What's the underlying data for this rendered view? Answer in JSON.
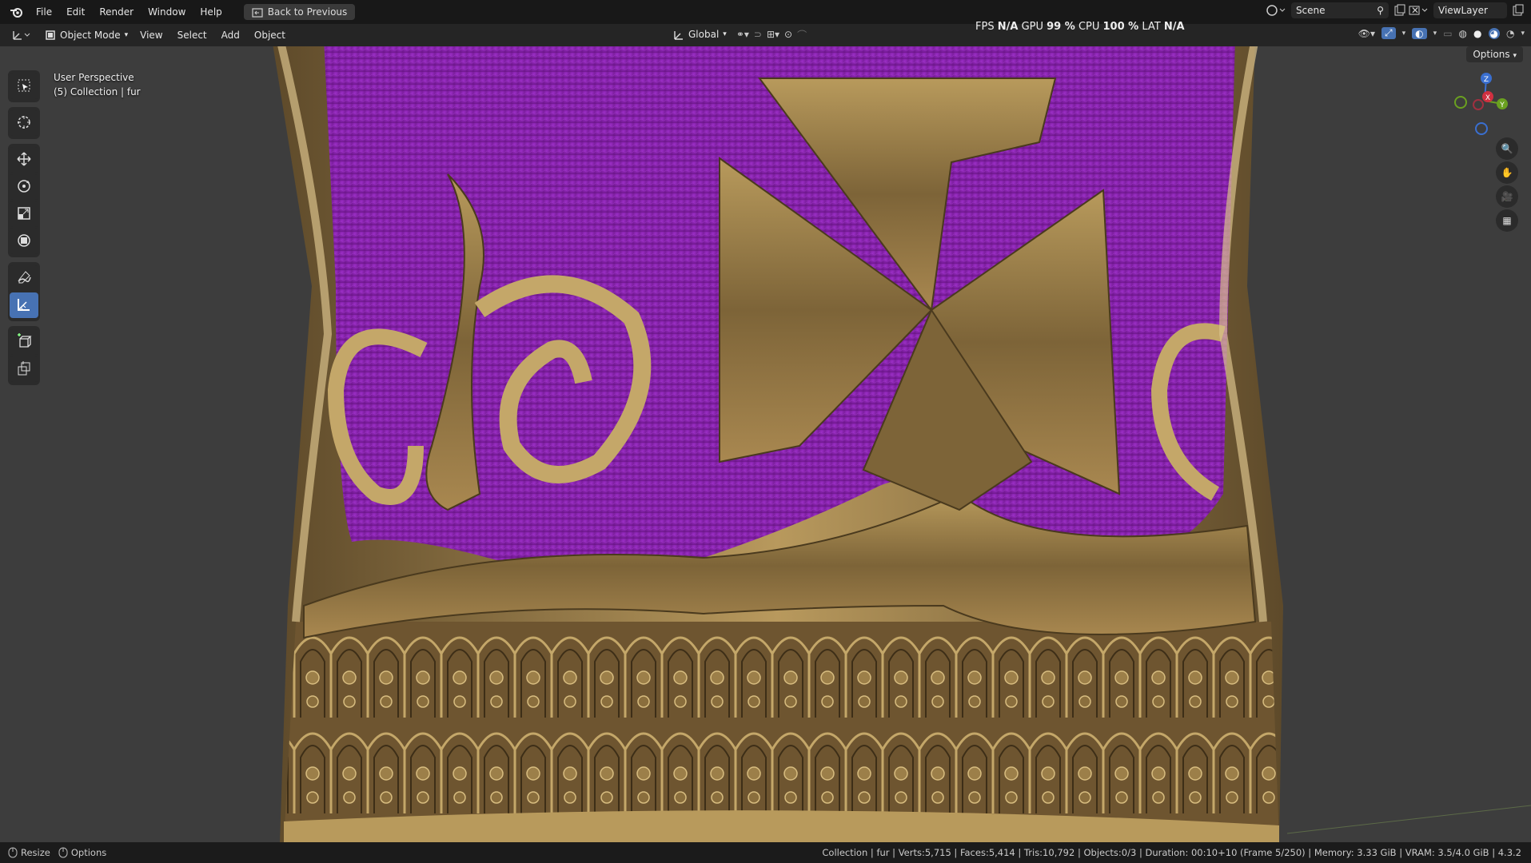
{
  "topbar": {
    "menus": [
      "File",
      "Edit",
      "Render",
      "Window",
      "Help"
    ],
    "back_button": "Back to Previous",
    "scene_label": "Scene",
    "viewlayer_label": "ViewLayer"
  },
  "header": {
    "mode": "Object Mode",
    "menus": [
      "View",
      "Select",
      "Add",
      "Object"
    ],
    "transform_orientation": "Global",
    "options_label": "Options"
  },
  "stats": {
    "fps_label": "FPS",
    "fps_value": "N/A",
    "gpu_label": "GPU",
    "gpu_value": "99 %",
    "cpu_label": "CPU",
    "cpu_value": "100 %",
    "lat_label": "LAT",
    "lat_value": "N/A"
  },
  "viewport": {
    "view_name": "User Perspective",
    "collection_info": "(5) Collection | fur",
    "colors": {
      "fur": "#8a1fb0",
      "gold": "#9a7c45",
      "background": "#3d3d3d"
    }
  },
  "gizmo": {
    "x_label": "X",
    "y_label": "Y",
    "z_label": "Z"
  },
  "toolbar": {
    "tools": [
      "select-box-icon",
      "cursor-icon",
      "move-icon",
      "rotate-icon",
      "scale-icon",
      "transform-icon",
      "annotate-icon",
      "measure-icon",
      "add-cube-icon",
      "extrude-icon"
    ],
    "active_tool": "measure-icon"
  },
  "statusbar": {
    "left_action": "Resize",
    "left_options": "Options",
    "info": "Collection | fur | Verts:5,715 | Faces:5,414 | Tris:10,792 | Objects:0/3 | Duration: 00:10+10 (Frame 5/250) | Memory: 3.33 GiB | VRAM: 3.5/4.0 GiB | 4.3.2"
  }
}
